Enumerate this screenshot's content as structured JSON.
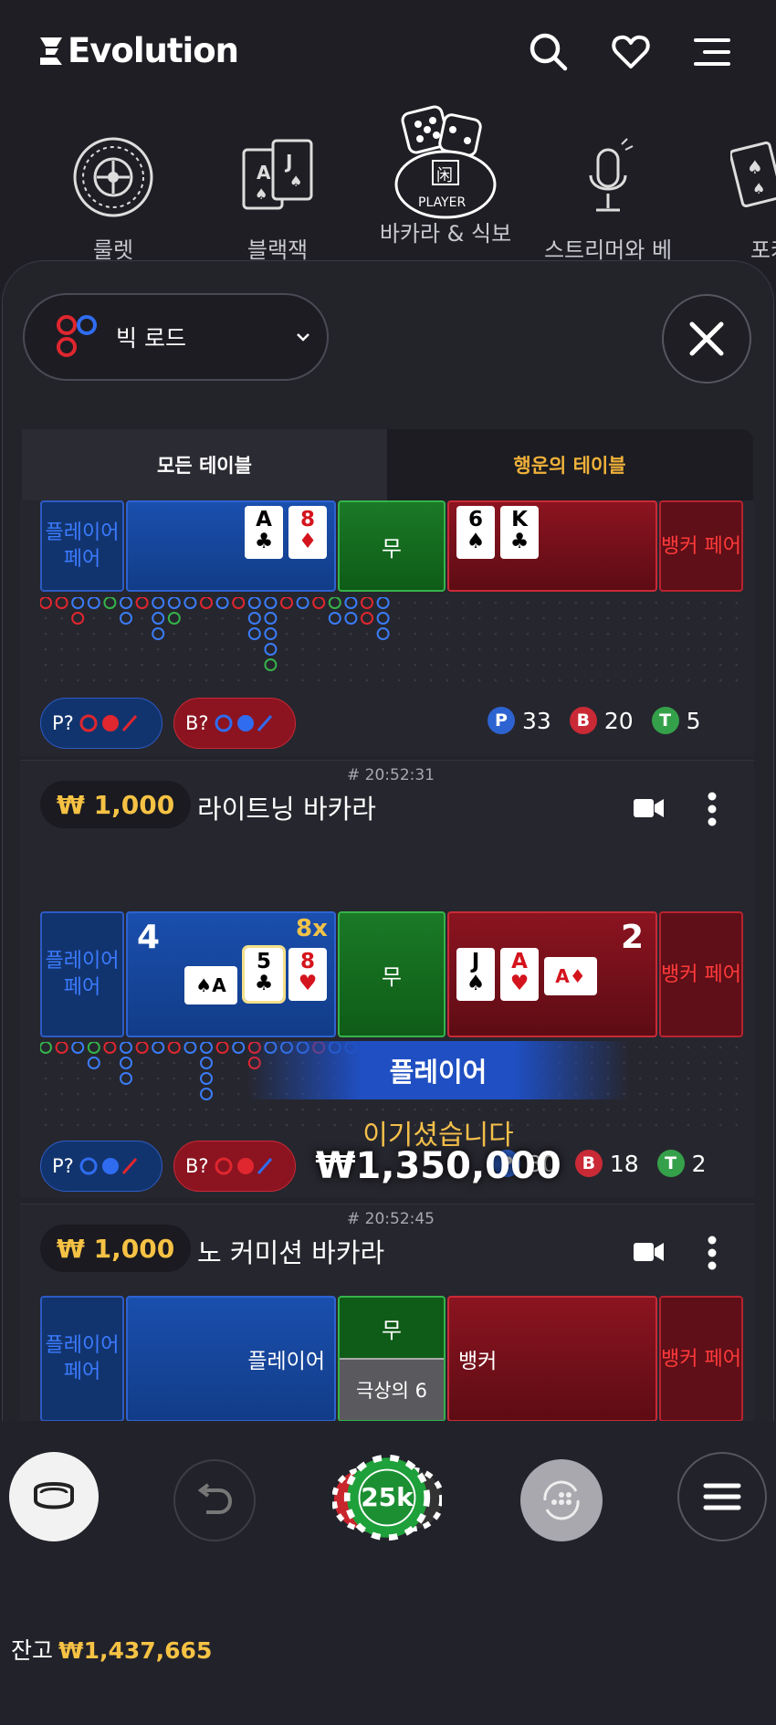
{
  "header": {
    "brand": "Evolution"
  },
  "categories": [
    {
      "label": "룰렛"
    },
    {
      "label": "블랙잭"
    },
    {
      "label": "바카라 & 식보",
      "active": true
    },
    {
      "label": "스트리머와 베"
    },
    {
      "label": "포커"
    }
  ],
  "road_selector": {
    "label": "빅 로드"
  },
  "tabs": {
    "all": "모든 테이블",
    "lucky": "행운의 테이블"
  },
  "labels": {
    "player_pair": "플레이어 페어",
    "banker_pair": "뱅커 페어",
    "tie": "무",
    "player": "플레이어",
    "banker": "뱅커",
    "super6": "극상의 6"
  },
  "table1": {
    "player_cards": [
      {
        "rank": "A",
        "suit": "♣"
      },
      {
        "rank": "8",
        "suit": "♦"
      }
    ],
    "banker_cards": [
      {
        "rank": "6",
        "suit": "♠"
      },
      {
        "rank": "K",
        "suit": "♣"
      }
    ],
    "pill_p": "P?",
    "pill_b": "B?",
    "count_p": "33",
    "count_b": "20",
    "count_t": "5"
  },
  "table2": {
    "round": "# 20:52:31",
    "stake": "₩ 1,000",
    "name": "라이트닝 바카라",
    "player_score": "4",
    "banker_score": "2",
    "multiplier": "8x",
    "player_cards": [
      {
        "rank": "A",
        "suit": "♠"
      },
      {
        "rank": "5",
        "suit": "♣"
      },
      {
        "rank": "8",
        "suit": "♥"
      }
    ],
    "banker_cards": [
      {
        "rank": "J",
        "suit": "♠"
      },
      {
        "rank": "A",
        "suit": "♥"
      },
      {
        "rank": "A",
        "suit": "♦"
      }
    ],
    "pill_p": "P?",
    "pill_b": "B?",
    "count_p": "30",
    "count_b": "18",
    "count_t": "2",
    "win_banner": "플레이어",
    "win_text": "이기셨습니다",
    "win_amount": "₩1,350,000"
  },
  "table3": {
    "round": "# 20:52:45",
    "stake": "₩ 1,000",
    "name": "노 커미션 바카라"
  },
  "bottom": {
    "chip_value": "25k",
    "balance_label": "잔고",
    "balance": "₩1,437,665"
  },
  "colors": {
    "accent_gold": "#f6c244",
    "player_blue": "#1a4fae",
    "banker_red": "#8b1420",
    "tie_green": "#1a7a26"
  }
}
